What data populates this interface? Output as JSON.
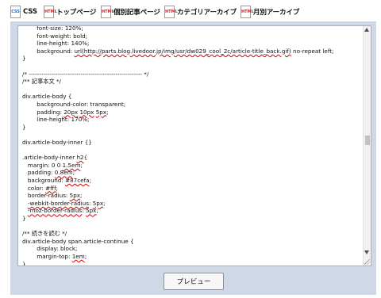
{
  "tabs": [
    {
      "label": "CSS",
      "icon": "css-file-icon",
      "icon_text": "CSS",
      "active": true
    },
    {
      "label": "トップページ",
      "icon": "html-file-icon",
      "icon_text": "HTML"
    },
    {
      "label": "個別記事ページ",
      "icon": "html-file-icon",
      "icon_text": "HTML"
    },
    {
      "label": "カテゴリアーカイブ",
      "icon": "html-file-icon",
      "icon_text": "HTML"
    },
    {
      "label": "月別アーカイブ",
      "icon": "html-file-icon",
      "icon_text": "HTML"
    }
  ],
  "editor": {
    "lines": [
      [
        {
          "t": "        font-size: 120%;"
        }
      ],
      [
        {
          "t": "        font-weight: bold;"
        }
      ],
      [
        {
          "t": "        line-height: 140%;"
        }
      ],
      [
        {
          "t": "        background: "
        },
        {
          "t": "url(http://parts.blog.livedoor.jp/img/usr/dw029_cool_2c/article-title_back.gif)",
          "sq": true
        },
        {
          "t": " no-repeat left;"
        }
      ],
      [
        {
          "t": "}"
        }
      ],
      [
        {
          "t": ""
        }
      ],
      [
        {
          "t": "/* ------------------------------------------------------- */"
        }
      ],
      [
        {
          "t": "/** 記事本文 */"
        }
      ],
      [
        {
          "t": ""
        }
      ],
      [
        {
          "t": "div.article-body {"
        }
      ],
      [
        {
          "t": "        background-color: transparent;"
        }
      ],
      [
        {
          "t": "        padding: "
        },
        {
          "t": "20px",
          "sq": true
        },
        {
          "t": " "
        },
        {
          "t": "10px",
          "sq": true
        },
        {
          "t": " "
        },
        {
          "t": "5px",
          "sq": true
        },
        {
          "t": ";"
        }
      ],
      [
        {
          "t": "        line-height: 170%;"
        }
      ],
      [
        {
          "t": "}"
        }
      ],
      [
        {
          "t": ""
        }
      ],
      [
        {
          "t": "div.article-body-inner {}"
        }
      ],
      [
        {
          "t": ""
        }
      ],
      [
        {
          "t": ".article-body-inner "
        },
        {
          "t": "h2",
          "sq": true
        },
        {
          "t": "{"
        }
      ],
      [
        {
          "t": "   margin: 0 0 "
        },
        {
          "t": "1.5em",
          "sq": true
        },
        {
          "t": ";"
        }
      ],
      [
        {
          "t": "   padding: "
        },
        {
          "t": "0.8em",
          "sq": true
        },
        {
          "t": ";"
        }
      ],
      [
        {
          "t": "   background: "
        },
        {
          "t": "#87cefa",
          "sq": true
        },
        {
          "t": ";"
        }
      ],
      [
        {
          "t": "   color: "
        },
        {
          "t": "#fff",
          "sq": true
        },
        {
          "t": ";"
        }
      ],
      [
        {
          "t": "   border-radius: "
        },
        {
          "t": "5px",
          "sq": true
        },
        {
          "t": ";"
        }
      ],
      [
        {
          "t": "   "
        },
        {
          "t": "-webkit-border-radius",
          "sq": true
        },
        {
          "t": ": "
        },
        {
          "t": "5px",
          "sq": true
        },
        {
          "t": ";"
        }
      ],
      [
        {
          "t": "   "
        },
        {
          "t": "-moz-border-radius",
          "sq": true
        },
        {
          "t": ": "
        },
        {
          "t": "5px",
          "sq": true
        },
        {
          "t": ";"
        }
      ],
      [
        {
          "t": "}"
        }
      ],
      [
        {
          "t": ""
        }
      ],
      [
        {
          "t": "/** 続きを読む */"
        }
      ],
      [
        {
          "t": "div.article-body span.article-continue {"
        }
      ],
      [
        {
          "t": "        display: block;"
        }
      ],
      [
        {
          "t": "        margin-top: "
        },
        {
          "t": "1em",
          "sq": true
        },
        {
          "t": ";"
        }
      ],
      [
        {
          "t": "}"
        }
      ]
    ]
  },
  "preview_button": {
    "label": "プレビュー"
  },
  "colors": {
    "panel_bg": "#cfd8e6",
    "squiggle": "#d80000",
    "css_icon": "#1e6fd0",
    "html_icon": "#d2202a"
  }
}
